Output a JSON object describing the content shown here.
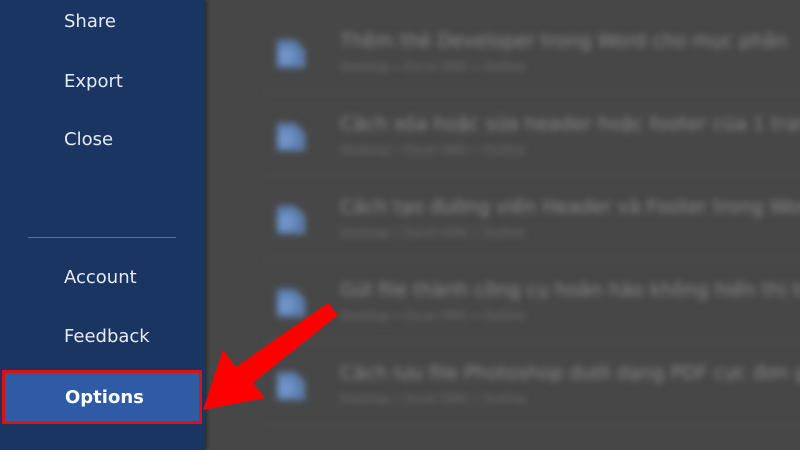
{
  "sidebar": {
    "items": [
      {
        "label": "Share"
      },
      {
        "label": "Export"
      },
      {
        "label": "Close"
      },
      {
        "label": "Account"
      },
      {
        "label": "Feedback"
      },
      {
        "label": "Options"
      }
    ],
    "highlight_color": "#e01010",
    "selected_bg": "#2e5aa6",
    "bg": "#1b3563"
  },
  "recent_docs": [
    {
      "title": "Thêm thẻ Developer trong Word cho mục phần",
      "path": "Desktop » Excel OMS » Outline"
    },
    {
      "title": "Cách xóa hoặc sửa header hoặc footer của 1 trang",
      "path": "Desktop » Excel OMS » Outline"
    },
    {
      "title": "Cách tạo đường viền Header và Footer trong Word",
      "path": "Desktop » Excel OMS » Outline"
    },
    {
      "title": "Gửi file thành công cụ hoàn hảo không hiển thị trên",
      "path": "Desktop » Excel OMS » Outline"
    },
    {
      "title": "Cách lưu file Photoshop dưới dạng PDF cực đơn giản",
      "path": "Desktop » Excel OMS » Outline"
    }
  ],
  "annotation": {
    "arrow_icon": "red-arrow-icon",
    "arrow_color": "#ff0000"
  }
}
